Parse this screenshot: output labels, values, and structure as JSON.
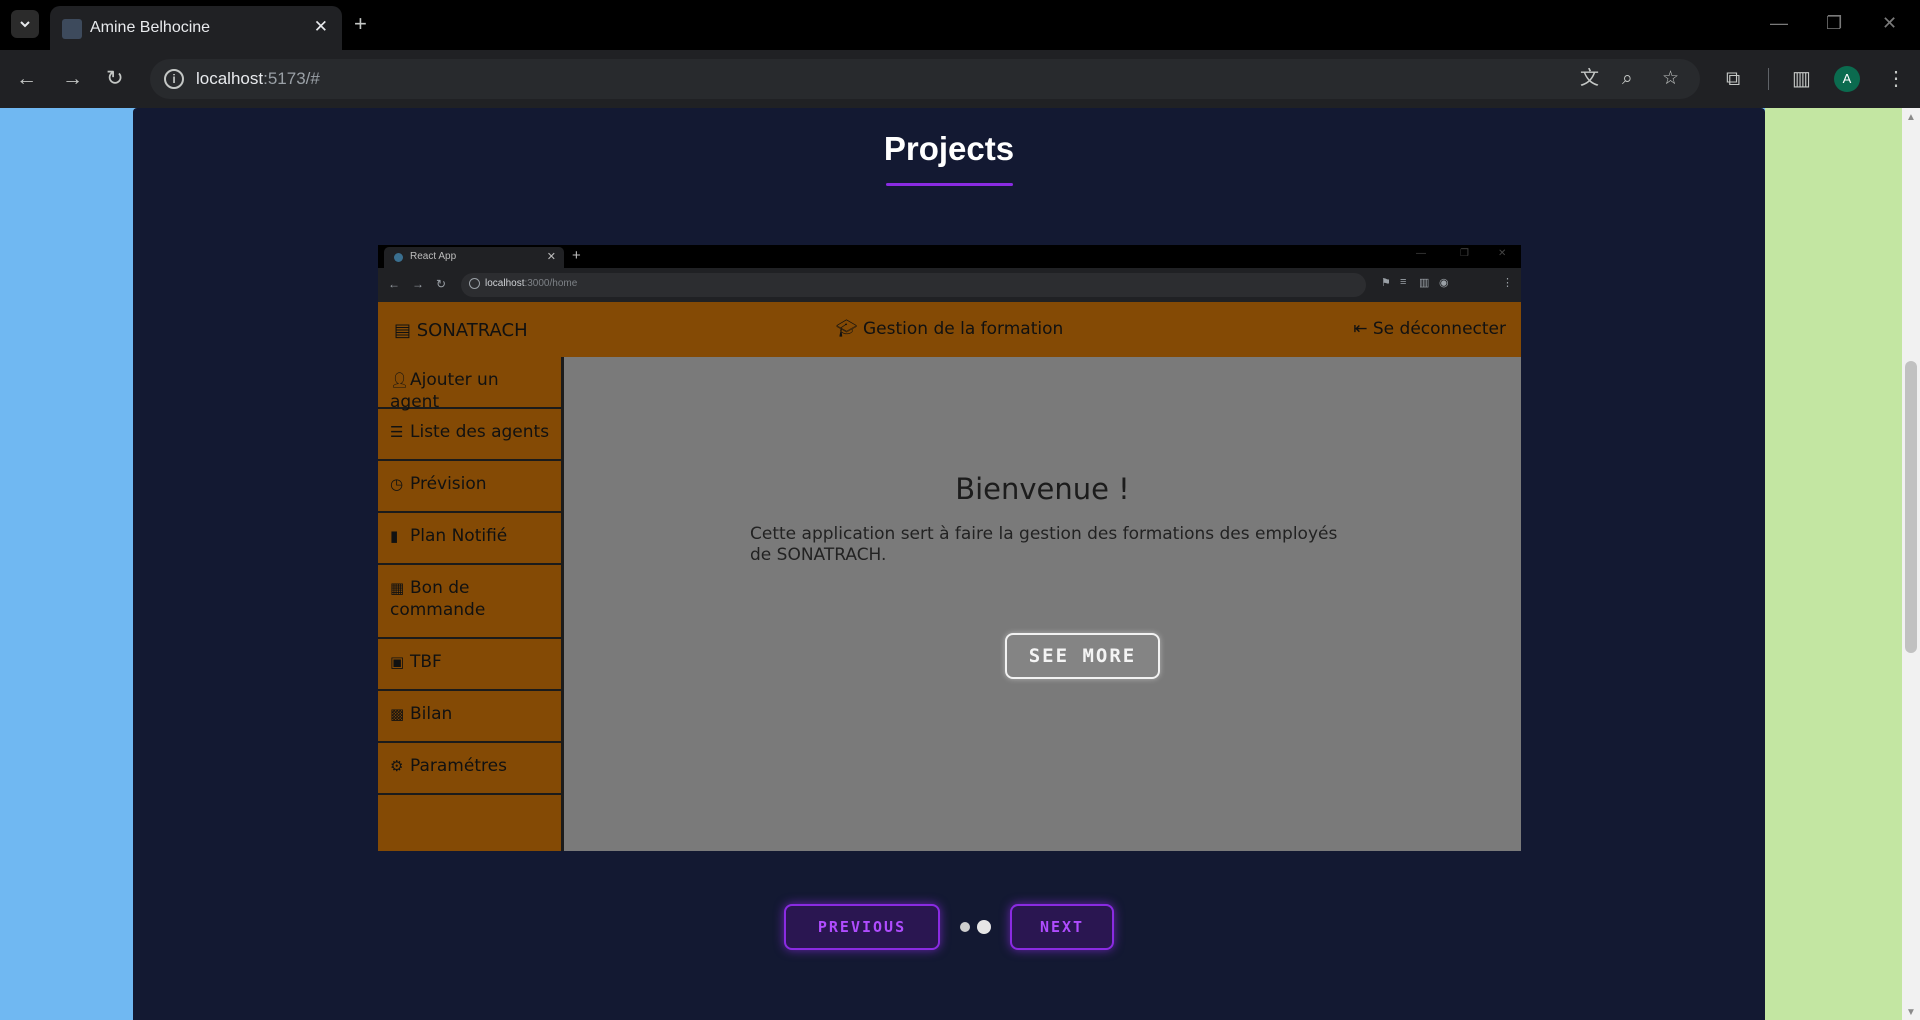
{
  "browser": {
    "tab_title": "Amine Belhocine",
    "url_host": "localhost",
    "url_rest": ":5173/#",
    "profile_initial": "A",
    "icons": [
      "tab-search-icon",
      "close-icon",
      "new-tab-icon",
      "back-icon",
      "forward-icon",
      "reload-icon",
      "site-info-icon",
      "translate-icon",
      "zoom-icon",
      "star-icon",
      "extensions-icon",
      "side-panel-icon",
      "menu-icon"
    ]
  },
  "page": {
    "title": "Projects",
    "accent": "#8a2be2",
    "background": "#131932"
  },
  "project": {
    "see_more_label": "SEE MORE",
    "screenshot": {
      "tab_title": "React App",
      "url_host": "localhost",
      "url_rest": ":3000/home",
      "brand": "SONATRACH",
      "header_center": "Gestion de la formation",
      "logout": "Se déconnecter",
      "sidebar": [
        {
          "label": "Ajouter un agent",
          "icon": "user-add-icon"
        },
        {
          "label": "Liste des agents",
          "icon": "user-list-icon"
        },
        {
          "label": "Prévision",
          "icon": "clock-icon"
        },
        {
          "label": "Plan Notifié",
          "icon": "bookmark-icon"
        },
        {
          "label": "Bon de commande",
          "icon": "order-icon"
        },
        {
          "label": "TBF",
          "icon": "table-icon"
        },
        {
          "label": "Bilan",
          "icon": "archive-icon"
        },
        {
          "label": "Paramétres",
          "icon": "gear-icon"
        }
      ],
      "welcome_title": "Bienvenue !",
      "welcome_text": "Cette application sert à faire la gestion des formations des employés de SONATRACH."
    }
  },
  "carousel": {
    "previous_label": "PREVIOUS",
    "next_label": "NEXT",
    "dots": 2,
    "active_index": 1
  }
}
